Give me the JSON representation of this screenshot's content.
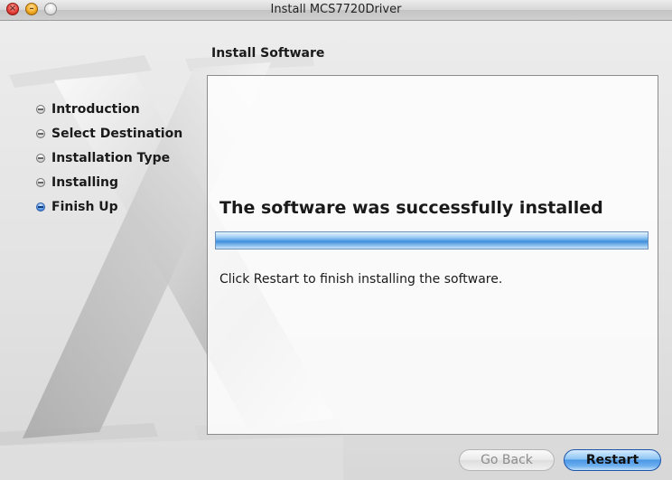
{
  "window": {
    "title": "Install MCS7720Driver"
  },
  "heading": "Install Software",
  "steps": [
    {
      "label": "Introduction",
      "active": false
    },
    {
      "label": "Select Destination",
      "active": false
    },
    {
      "label": "Installation Type",
      "active": false
    },
    {
      "label": "Installing",
      "active": false
    },
    {
      "label": "Finish Up",
      "active": true
    }
  ],
  "content": {
    "status_heading": "The software was successfully installed",
    "progress": 1.0,
    "instruction": "Click Restart to finish installing the software."
  },
  "buttons": {
    "go_back": {
      "label": "Go Back",
      "enabled": false
    },
    "restart": {
      "label": "Restart",
      "enabled": true
    }
  },
  "icons": {
    "close": "close-icon",
    "minimize": "minimize-icon",
    "zoom": "zoom-icon",
    "step_bullet": "step-bullet-icon",
    "logo": "mac-os-x-logo"
  }
}
